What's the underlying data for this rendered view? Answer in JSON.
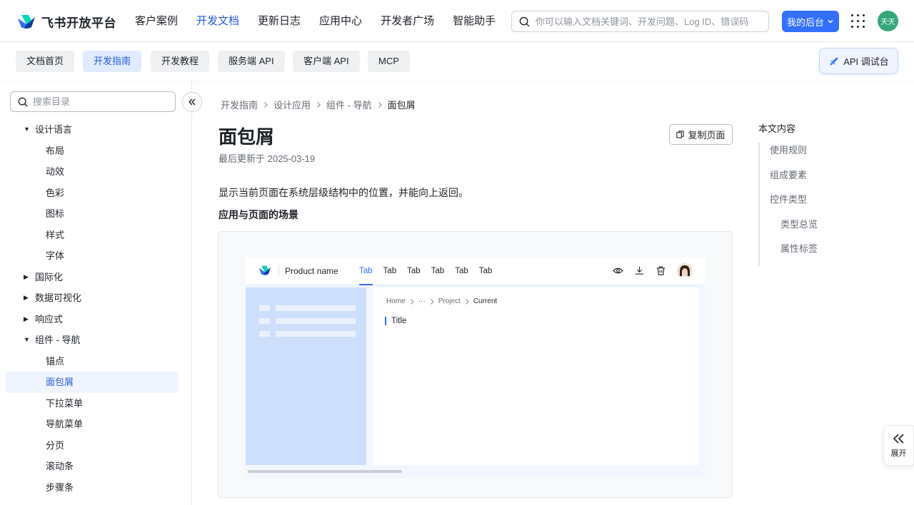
{
  "header": {
    "logo_text": "飞书开放平台",
    "nav": [
      "客户案例",
      "开发文档",
      "更新日志",
      "应用中心",
      "开发者广场",
      "智能助手"
    ],
    "nav_active_index": 1,
    "search_placeholder": "你可以输入文档关键词、开发问题、Log ID、错误码",
    "console_label": "我的后台",
    "avatar_text": "天天"
  },
  "subnav": {
    "tabs": [
      "文档首页",
      "开发指南",
      "开发教程",
      "服务端 API",
      "客户端 API",
      "MCP"
    ],
    "active_index": 1,
    "api_button": "API 调试台"
  },
  "sidebar": {
    "search_placeholder": "搜索目录",
    "items": [
      {
        "label": "设计语言",
        "level": 1,
        "caret": "▼"
      },
      {
        "label": "布局",
        "level": 2
      },
      {
        "label": "动效",
        "level": 2
      },
      {
        "label": "色彩",
        "level": 2
      },
      {
        "label": "图标",
        "level": 2
      },
      {
        "label": "样式",
        "level": 2
      },
      {
        "label": "字体",
        "level": 2
      },
      {
        "label": "国际化",
        "level": 1,
        "caret": "▶"
      },
      {
        "label": "数据可视化",
        "level": 1,
        "caret": "▶"
      },
      {
        "label": "响应式",
        "level": 1,
        "caret": "▶"
      },
      {
        "label": "组件 - 导航",
        "level": 1,
        "caret": "▼"
      },
      {
        "label": "锚点",
        "level": 2
      },
      {
        "label": "面包屑",
        "level": 2,
        "selected": true
      },
      {
        "label": "下拉菜单",
        "level": 2
      },
      {
        "label": "导航菜单",
        "level": 2
      },
      {
        "label": "分页",
        "level": 2
      },
      {
        "label": "滚动条",
        "level": 2
      },
      {
        "label": "步骤条",
        "level": 2
      }
    ]
  },
  "main": {
    "breadcrumb": [
      "开发指南",
      "设计应用",
      "组件 - 导航",
      "面包屑"
    ],
    "title": "面包屑",
    "updated": "最后更新于 2025-03-19",
    "copy_button": "复制页面",
    "description": "显示当前页面在系统层级结构中的位置，并能向上返回。",
    "subheading": "应用与页面的场景",
    "demo": {
      "product_name": "Product name",
      "tabs": [
        "Tab",
        "Tab",
        "Tab",
        "Tab",
        "Tab",
        "Tab"
      ],
      "breadcrumb": [
        "Home",
        "···",
        "Project",
        "Current"
      ],
      "title": "Title"
    }
  },
  "toc": {
    "title": "本文内容",
    "items": [
      {
        "label": "使用规则",
        "sub": false
      },
      {
        "label": "组成要素",
        "sub": false
      },
      {
        "label": "控件类型",
        "sub": false
      },
      {
        "label": "类型总览",
        "sub": true
      },
      {
        "label": "属性标签",
        "sub": true
      }
    ]
  },
  "expand_label": "展开",
  "colors": {
    "accent": "#3370ff",
    "active_text": "#245bdb",
    "selected_bg": "#f0f4ff"
  }
}
